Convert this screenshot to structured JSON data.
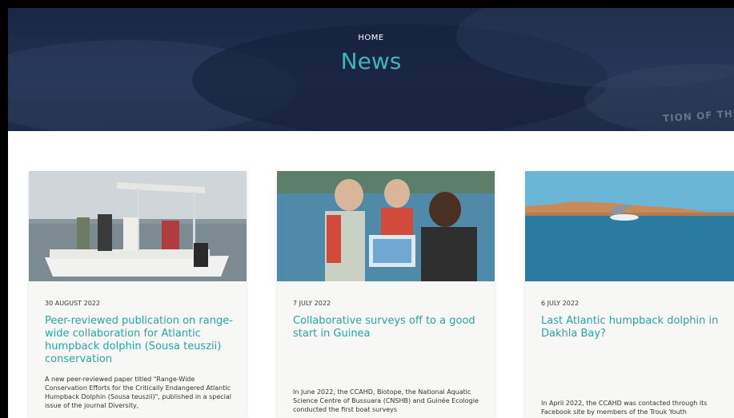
{
  "hero": {
    "breadcrumb": "HOME",
    "title": "News",
    "watermark": "TION OF THE"
  },
  "cards": [
    {
      "date": "30 AUGUST 2022",
      "title": "Peer-reviewed publication on range-wide collaboration for Atlantic humpback dolphin (Sousa teuszii) conservation",
      "excerpt": "A new peer-reviewed paper titled \"Range-Wide Conservation Efforts for the Critically Endangered Atlantic Humpback Dolphin (Sousa teuszii)\", published in a special issue of the journal Diversity,"
    },
    {
      "date": "7 JULY 2022",
      "title": "Collaborative surveys off to a good start in Guinea",
      "excerpt": "In June 2022, the CCAHD, Biotope, the National Aquatic Science Centre of Bussuara (CNSHB) and Guinée Ecologie conducted the first boat surveys"
    },
    {
      "date": "6 JULY 2022",
      "title": "Last Atlantic humpback dolphin in Dakhla Bay?",
      "excerpt": "In April 2022, the CCAHD was contacted through its Facebook site by members of the Trouk Youth"
    }
  ]
}
